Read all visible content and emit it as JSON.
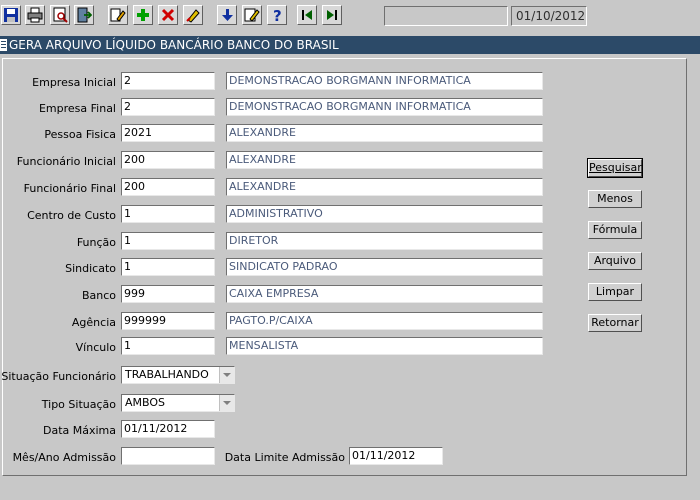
{
  "toolbar": {
    "icons": [
      "save-icon",
      "print-icon",
      "print-preview-icon",
      "exit-icon",
      "query-icon",
      "add-icon",
      "delete-icon",
      "clear-icon",
      "download-icon",
      "edit-icon",
      "help-icon",
      "previous-icon",
      "next-icon"
    ],
    "status_text": "",
    "date": "01/10/2012"
  },
  "window": {
    "title": "GERA ARQUIVO LÍQUIDO BANCÁRIO BANCO DO BRASIL"
  },
  "form": {
    "empresa_inicial": {
      "label": "Empresa Inicial",
      "code": "2",
      "desc": "DEMONSTRACAO BORGMANN INFORMATICA"
    },
    "empresa_final": {
      "label": "Empresa Final",
      "code": "2",
      "desc": "DEMONSTRACAO BORGMANN INFORMATICA"
    },
    "pessoa_fisica": {
      "label": "Pessoa Fisica",
      "code": "2021",
      "desc": "ALEXANDRE"
    },
    "funcionario_inicial": {
      "label": "Funcionário Inicial",
      "code": "200",
      "desc": "ALEXANDRE"
    },
    "funcionario_final": {
      "label": "Funcionário Final",
      "code": "200",
      "desc": "ALEXANDRE"
    },
    "centro_custo": {
      "label": "Centro de Custo",
      "code": "1",
      "desc": "ADMINISTRATIVO"
    },
    "funcao": {
      "label": "Função",
      "code": "1",
      "desc": "DIRETOR"
    },
    "sindicato": {
      "label": "Sindicato",
      "code": "1",
      "desc": "SINDICATO PADRAO"
    },
    "banco": {
      "label": "Banco",
      "code": "999",
      "desc": "CAIXA EMPRESA"
    },
    "agencia": {
      "label": "Agência",
      "code": "999999",
      "desc": "PAGTO.P/CAIXA"
    },
    "vinculo": {
      "label": "Vínculo",
      "code": "1",
      "desc": "MENSALISTA"
    },
    "situacao_funcionario": {
      "label": "Situação Funcionário",
      "value": "TRABALHANDO"
    },
    "tipo_situacao": {
      "label": "Tipo Situação",
      "value": "AMBOS"
    },
    "data_maxima": {
      "label": "Data Máxima",
      "value": "01/11/2012"
    },
    "mes_ano_admissao": {
      "label": "Mês/Ano Admissão",
      "value": ""
    },
    "data_limite_admissao": {
      "label": "Data Limite Admissão",
      "value": "01/11/2012"
    }
  },
  "buttons": {
    "pesquisar": "Pesquisar",
    "menos": "Menos",
    "formula": "Fórmula",
    "arquivo": "Arquivo",
    "limpar": "Limpar",
    "retornar": "Retornar"
  },
  "colors": {
    "title_bar": "#2c4a68",
    "background": "#c8c8c8",
    "desc_text": "#4a5a7a"
  }
}
